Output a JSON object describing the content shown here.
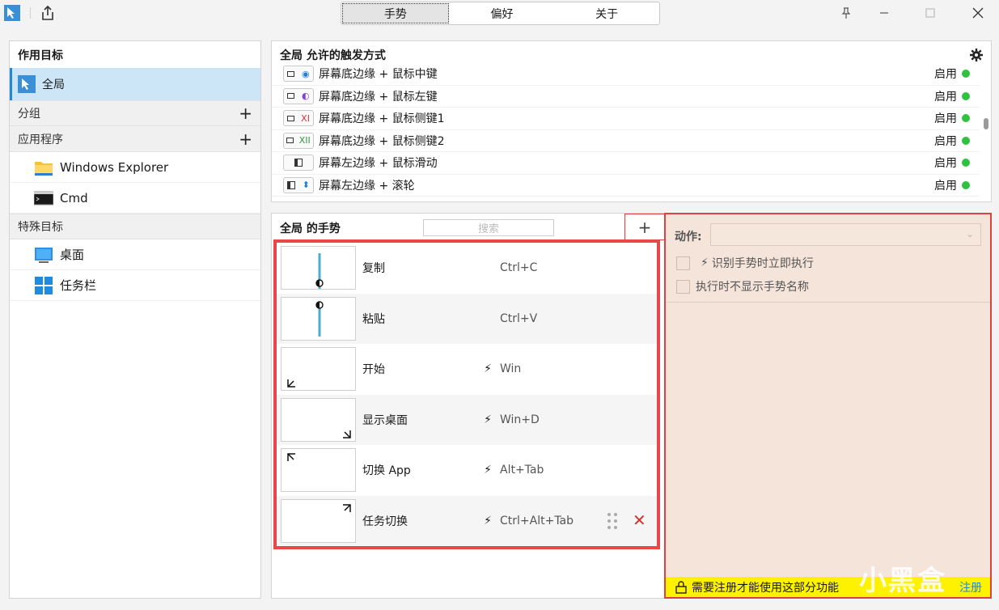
{
  "titlebar": {
    "tabs": [
      "手势",
      "偏好",
      "关于"
    ],
    "active_tab": 0
  },
  "left": {
    "header": "作用目标",
    "selected": "全局",
    "groups_label": "分组",
    "apps_label": "应用程序",
    "apps": [
      "Windows Explorer",
      "Cmd"
    ],
    "special_label": "特殊目标",
    "special": [
      "桌面",
      "任务栏"
    ]
  },
  "triggers": {
    "title": "全局 允许的触发方式",
    "rows": [
      {
        "icon": "mouse-middle",
        "label": "屏幕底边缘 + 鼠标中键",
        "status": "启用"
      },
      {
        "icon": "mouse-left",
        "label": "屏幕底边缘 + 鼠标左键",
        "status": "启用"
      },
      {
        "icon": "mouse-x1",
        "label": "屏幕底边缘 + 鼠标侧键1",
        "status": "启用"
      },
      {
        "icon": "mouse-x2",
        "label": "屏幕底边缘 + 鼠标侧键2",
        "status": "启用"
      },
      {
        "icon": "mouse-slide",
        "label": "屏幕左边缘 + 鼠标滑动",
        "status": "启用"
      },
      {
        "icon": "scroll-wheel",
        "label": "屏幕左边缘 + 滚轮",
        "status": "启用"
      }
    ]
  },
  "gestures": {
    "title": "全局 的手势",
    "search_placeholder": "搜索",
    "add_label": "+",
    "rows": [
      {
        "name": "复制",
        "bolt": false,
        "key": "Ctrl+C",
        "thumb": "line-up"
      },
      {
        "name": "粘贴",
        "bolt": false,
        "key": "Ctrl+V",
        "thumb": "line-down"
      },
      {
        "name": "开始",
        "bolt": true,
        "key": "Win",
        "thumb": "corner-bl"
      },
      {
        "name": "显示桌面",
        "bolt": true,
        "key": "Win+D",
        "thumb": "corner-br"
      },
      {
        "name": "切换 App",
        "bolt": true,
        "key": "Alt+Tab",
        "thumb": "corner-tl"
      },
      {
        "name": "任务切换",
        "bolt": true,
        "key": "Ctrl+Alt+Tab",
        "thumb": "corner-tr"
      }
    ]
  },
  "action": {
    "label": "动作:",
    "check1": "识别手势时立即执行",
    "check2": "执行时不显示手势名称",
    "lock_text": "需要注册才能使用这部分功能",
    "register": "注册"
  },
  "watermark": "小黑盒"
}
